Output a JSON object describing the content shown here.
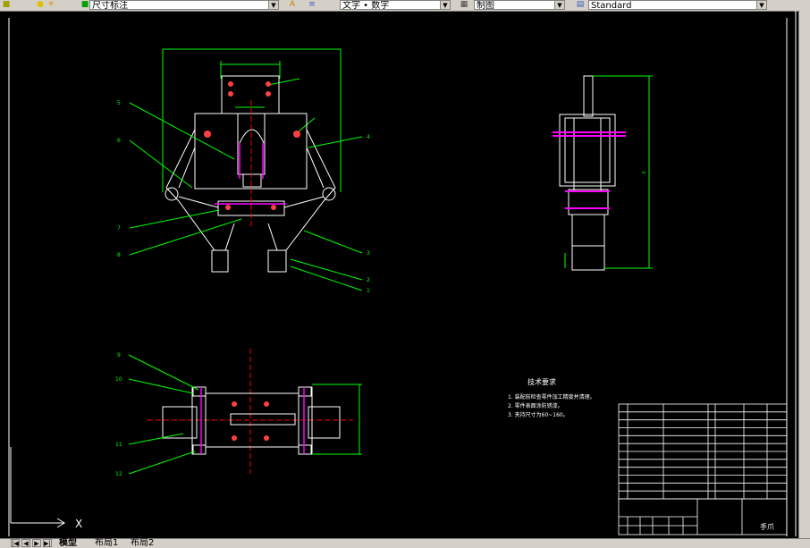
{
  "toolbar": {
    "dimstyle_value": "尺寸标注",
    "textstyle_value": "文字 • 数字",
    "layer_value": "制图",
    "tablestyle_value": "Standard"
  },
  "tabs": {
    "model": "模型",
    "layout1": "布局1",
    "layout2": "布局2"
  },
  "ucs": {
    "x_label": "X"
  },
  "drawing": {
    "tech_req": {
      "title": "技术要求",
      "lines": [
        "1. 装配前检查零件加工精度并清理。",
        "2. 零件表面涂防锈漆。",
        "3. 夹持尺寸为60~160。"
      ]
    },
    "title_block": {
      "name": "手爪"
    },
    "leader_numbers_front_left": [
      "5",
      "6",
      "7",
      "8"
    ],
    "leader_numbers_front_right": [
      "4",
      "3",
      "2",
      "1"
    ],
    "leader_numbers_top": [
      "9",
      "10",
      "11",
      "12"
    ]
  },
  "colors": {
    "background": "#000000",
    "outline": "#ffffff",
    "dimension": "#00ff00",
    "centerline": "#ff0000",
    "highlight": "#ff00ff",
    "leader": "#00ff00"
  }
}
